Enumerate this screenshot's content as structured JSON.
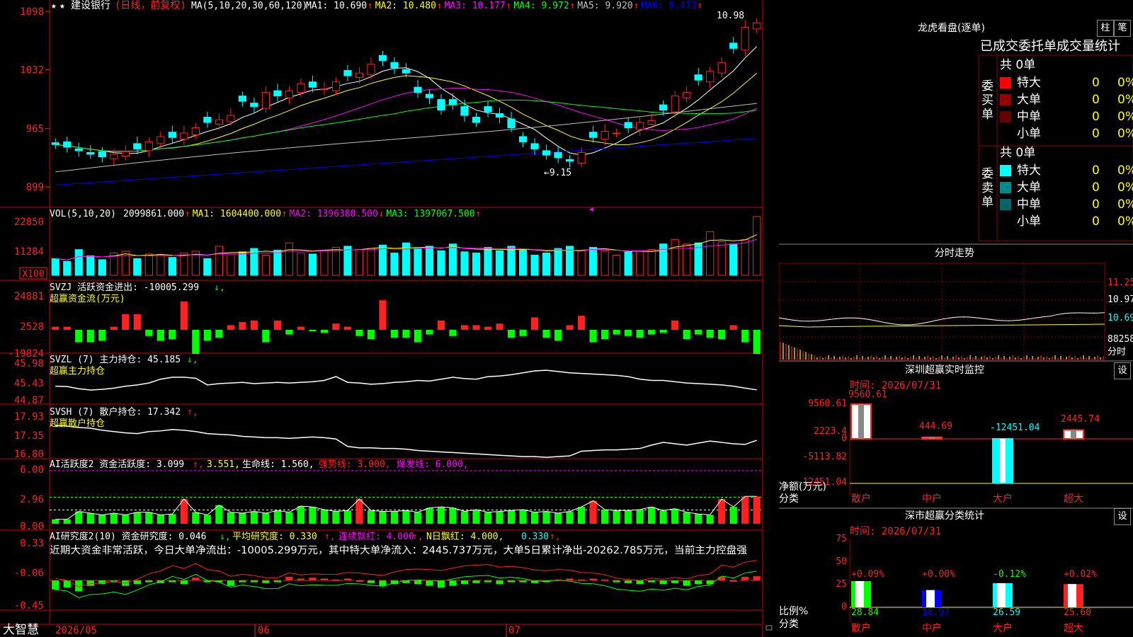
{
  "app": {
    "brand": "大智慧"
  },
  "toolbar": {
    "star_icon": "★",
    "stock_name": "建设银行",
    "period": "(日线，前复权)"
  },
  "colors": {
    "up": "#ff2020",
    "down": "#00ffff",
    "green": "#00ff00",
    "grid": "#8b0000",
    "yellow": "#ffff00",
    "magenta": "#ff00ff",
    "ma1": "#ffffff",
    "ma2": "#ffff00",
    "ma3": "#ff00ff",
    "ma4": "#00ff00",
    "ma5": "#c0c0c0",
    "ma6": "#0000ff"
  },
  "main": {
    "ma_params": "MA(5,10,20,30,60,120)",
    "ma": [
      {
        "label": "MA1: 10.690",
        "arrow": "↑",
        "color": "#ffffff"
      },
      {
        "label": "MA2: 10.480",
        "arrow": "↑",
        "color": "#ffff00"
      },
      {
        "label": "MA3: 10.177",
        "arrow": "↑",
        "color": "#ff00ff"
      },
      {
        "label": "MA4: 9.972",
        "arrow": "↑",
        "color": "#00ff00"
      },
      {
        "label": "MA5: 9.920",
        "arrow": "↑",
        "color": "#c0c0c0"
      },
      {
        "label": "MA6: 9.471",
        "arrow": "↑",
        "color": "#0000ff"
      }
    ],
    "high_label": "10.98",
    "low_label": "←9.15",
    "y_ticks": [
      "1098",
      "1032",
      "965",
      "899"
    ]
  },
  "vol": {
    "header": "VOL(5,10,20)",
    "items": [
      {
        "label": "2099861.000",
        "arrow": "↑",
        "color": "#ffffff"
      },
      {
        "label": "MA1: 1604400.000",
        "arrow": "↑",
        "color": "#ffff00"
      },
      {
        "label": "MA2: 1396380.500",
        "arrow": "↓",
        "color": "#ff00ff"
      },
      {
        "label": "MA3: 1397067.500",
        "arrow": "↑",
        "color": "#00ff00"
      }
    ],
    "y_ticks": [
      "22850",
      "11284"
    ],
    "unit": "X100"
  },
  "svzj": {
    "title": "SVZJ  活跃资金进出: -10005.299",
    "arrow": "↓,",
    "subtitle": "超赢资金流(万元)",
    "y_ticks": [
      "24881",
      "2528",
      "-19824"
    ]
  },
  "svzl": {
    "title": "SVZL (7) 主力持仓: 45.185",
    "arrow": "↓,",
    "subtitle": "超赢主力持仓",
    "y_ticks": [
      "45.98",
      "45.43",
      "44.87"
    ]
  },
  "svsh": {
    "title": "SVSH (7) 散户持仓: 17.342",
    "arrow": "↑,",
    "subtitle": "超赢散户持仓",
    "y_ticks": [
      "17.93",
      "17.35",
      "16.80"
    ]
  },
  "ai1": {
    "title": "AI活跃度2 资金活跃度: 3.099",
    "a1": "↑,",
    "v2": "3.551,",
    "v3": "生命线: 1.560,",
    "v4": "强势线: 3.000,",
    "v5": "爆发线: 6.000,",
    "y_ticks": [
      "6.00",
      "2.96",
      "0.00"
    ]
  },
  "ai2": {
    "title": "AI研究度2(10) 资金研究度: 0.046",
    "a1": "↓,",
    "v2": "平均研究度: 0.330",
    "a2": "↑,",
    "v3": "连续飘红: 4.000",
    "a3": "↑,",
    "v4": "N日飘红: 4.000,",
    "v5": "0.330",
    "a5": "↑,",
    "desc": "近期大资金非常活跃，今日大单净流出：-10005.299万元，其中特大单净流入：2445.737万元，大单5日累计净出-20262.785万元，当前主力控盘强",
    "y_ticks": [
      "0.33",
      "-0.06",
      "-0.45"
    ]
  },
  "xaxis": {
    "labels": [
      "2026/05",
      "06",
      "07"
    ]
  },
  "lhb": {
    "title": "龙虎看盘(逐单)",
    "btn_bar": "柱",
    "btn_pen": "笔",
    "header": "已成交委托单成交量统计",
    "buy_label": [
      "委",
      "买",
      "单"
    ],
    "sell_label": [
      "委",
      "卖",
      "单"
    ],
    "buy_total": "共 0单",
    "sell_total": "共 0单",
    "buy_rows": [
      {
        "name": "特大",
        "count": "0",
        "pct": "0%",
        "color": "#ff0000"
      },
      {
        "name": "大单",
        "count": "0",
        "pct": "0%",
        "color": "#990000"
      },
      {
        "name": "中单",
        "count": "0",
        "pct": "0%",
        "color": "#660000"
      },
      {
        "name": "小单",
        "count": "0",
        "pct": "0%",
        "color": "#000000"
      }
    ],
    "sell_rows": [
      {
        "name": "特大",
        "count": "0",
        "pct": "0%",
        "color": "#00ffff"
      },
      {
        "name": "大单",
        "count": "0",
        "pct": "0%",
        "color": "#008b8b"
      },
      {
        "name": "中单",
        "count": "0",
        "pct": "0%",
        "color": "#006666"
      },
      {
        "name": "小单",
        "count": "0",
        "pct": "0%",
        "color": "#000000"
      }
    ]
  },
  "intraday": {
    "title": "分时走势",
    "labels": [
      "11.25",
      "10.97",
      "10.69",
      "88258",
      "分时"
    ]
  },
  "monitor": {
    "title": "深圳超赢实时监控",
    "btn": "设",
    "time": "时间: 2026/07/31",
    "y_ticks": [
      "9560.61",
      "2223.4",
      "0",
      "-5113.82",
      "-12451.04"
    ],
    "unit": "净额(万元)",
    "cat_label": "分类",
    "categories": [
      "散户",
      "中户",
      "大户",
      "超大"
    ],
    "value_labels": [
      "9560.61",
      "444.69",
      "-12451.04",
      "2445.74"
    ]
  },
  "classify": {
    "title": "深市超赢分类统计",
    "btn": "设",
    "time": "时间: 2026/07/31",
    "y_ticks": [
      "75",
      "50",
      "25",
      "0"
    ],
    "unit": "比例%",
    "cat_label": "分类",
    "categories": [
      "散户",
      "中户",
      "大户",
      "超大"
    ],
    "change_labels": [
      "+0.09%",
      "+0.00%",
      "-0.12%",
      "+0.02%"
    ],
    "value_labels": [
      "28.84",
      "18.97",
      "26.59",
      "25.60"
    ]
  },
  "chart_data": [
    {
      "type": "candlestick",
      "title": "建设银行",
      "x": [
        "2026/05",
        "06",
        "07"
      ],
      "ohlc_count": 61,
      "ylim": [
        8.99,
        10.98
      ],
      "note_high": 10.98,
      "note_low": 9.15,
      "close": [
        9.47,
        9.44,
        9.4,
        9.36,
        9.33,
        9.36,
        9.39,
        9.42,
        9.5,
        9.56,
        9.55,
        9.6,
        9.66,
        9.72,
        9.75,
        9.8,
        9.96,
        9.9,
        10.06,
        10.02,
        10.08,
        10.16,
        10.12,
        10.1,
        10.18,
        10.25,
        10.28,
        10.38,
        10.42,
        10.34,
        10.28,
        10.06,
        10.0,
        9.86,
        9.92,
        9.8,
        9.72,
        9.84,
        9.78,
        9.66,
        9.5,
        9.42,
        9.35,
        9.32,
        9.28,
        9.38,
        9.55,
        9.62,
        9.6,
        9.66,
        9.72,
        9.74,
        9.86,
        10.02,
        10.06,
        10.2,
        10.3,
        10.4,
        10.56,
        10.8,
        10.85
      ],
      "volume": [
        30,
        25,
        46,
        35,
        28,
        40,
        43,
        30,
        38,
        36,
        32,
        40,
        43,
        30,
        52,
        38,
        42,
        48,
        36,
        45,
        58,
        40,
        38,
        44,
        50,
        52,
        46,
        48,
        54,
        40,
        58,
        48,
        52,
        44,
        56,
        42,
        40,
        50,
        44,
        52,
        46,
        36,
        40,
        48,
        52,
        44,
        50,
        44,
        36,
        42,
        44,
        46,
        56,
        64,
        56,
        58,
        78,
        60,
        56,
        64,
        105
      ]
    },
    {
      "type": "bar",
      "title": "SVZJ",
      "values": [
        2,
        2,
        -8,
        -8,
        -7,
        2,
        10,
        10,
        -4,
        -7,
        -6,
        24881,
        -19824,
        -7,
        -5,
        3,
        5,
        6,
        -8,
        6,
        -3,
        2,
        -1,
        -2,
        4,
        2,
        -4,
        -6,
        19,
        -5,
        -5,
        -8,
        -3,
        6,
        -4,
        3,
        3,
        2,
        4,
        -5,
        -4,
        8,
        -5,
        -7,
        3,
        9,
        -8,
        -6,
        -3,
        -4,
        -5,
        -3,
        -2,
        6,
        -6,
        -3,
        -5,
        -6,
        3,
        -8,
        -10005
      ]
    },
    {
      "type": "line",
      "title": "SVZL",
      "ylim": [
        44.87,
        45.98
      ],
      "values": [
        45.3,
        45.29,
        45.22,
        45.18,
        45.2,
        45.24,
        45.3,
        45.34,
        45.4,
        45.52,
        45.58,
        45.58,
        45.55,
        45.34,
        45.38,
        45.4,
        45.42,
        45.38,
        45.4,
        45.42,
        45.4,
        45.42,
        45.44,
        45.48,
        45.6,
        45.42,
        45.4,
        45.36,
        45.38,
        45.42,
        45.44,
        45.48,
        45.46,
        45.52,
        45.58,
        45.54,
        45.52,
        45.6,
        45.62,
        45.66,
        45.72,
        45.78,
        45.8,
        45.76,
        45.72,
        45.7,
        45.68,
        45.66,
        45.64,
        45.6,
        45.52,
        45.48,
        45.48,
        45.44,
        45.4,
        45.38,
        45.36,
        45.34,
        45.3,
        45.24,
        45.185
      ]
    },
    {
      "type": "line",
      "title": "SVSH",
      "ylim": [
        16.8,
        17.93
      ],
      "values": [
        17.78,
        17.76,
        17.72,
        17.7,
        17.64,
        17.6,
        17.56,
        17.54,
        17.6,
        17.62,
        17.66,
        17.64,
        17.6,
        17.54,
        17.52,
        17.5,
        17.46,
        17.44,
        17.42,
        17.42,
        17.4,
        17.42,
        17.44,
        17.42,
        17.38,
        17.16,
        17.12,
        17.12,
        17.1,
        17.1,
        17.08,
        17.04,
        17.02,
        17.0,
        16.98,
        16.96,
        16.94,
        16.92,
        16.9,
        16.88,
        16.86,
        16.86,
        16.84,
        16.86,
        16.88,
        17.02,
        17.04,
        17.06,
        17.06,
        17.08,
        17.1,
        17.2,
        17.28,
        17.24,
        17.2,
        17.26,
        17.32,
        17.28,
        17.24,
        17.22,
        17.342
      ]
    },
    {
      "type": "bar",
      "title": "AI活跃度2",
      "ylim": [
        0,
        6
      ],
      "series_lines": [
        {
          "name": "生命线",
          "value": 1.56
        },
        {
          "name": "强势线",
          "value": 3.0
        },
        {
          "name": "爆发线",
          "value": 6.0
        }
      ],
      "values": [
        0.5,
        0.5,
        1.4,
        1.2,
        1.0,
        1.2,
        1.0,
        1.3,
        1.3,
        1.0,
        1.1,
        2.8,
        1.3,
        1.0,
        2.1,
        1.3,
        1.2,
        1.4,
        1.2,
        1.5,
        1.3,
        2.0,
        1.9,
        1.6,
        1.4,
        1.5,
        2.8,
        1.5,
        1.4,
        1.4,
        1.5,
        1.3,
        1.8,
        1.9,
        1.8,
        1.4,
        1.6,
        1.3,
        1.4,
        1.5,
        1.6,
        1.3,
        1.4,
        1.2,
        1.4,
        1.9,
        2.6,
        1.6,
        1.5,
        1.5,
        1.6,
        1.9,
        1.5,
        1.7,
        1.3,
        1.1,
        1.0,
        2.8,
        1.9,
        3.1,
        3.099
      ]
    },
    {
      "type": "bar",
      "title": "AI研究度2",
      "ylim": [
        -0.45,
        0.33
      ],
      "values": [
        -0.1,
        -0.08,
        -0.12,
        -0.06,
        -0.04,
        -0.02,
        -0.06,
        -0.04,
        -0.02,
        -0.03,
        -0.02,
        -0.04,
        0.03,
        -0.02,
        -0.02,
        -0.06,
        -0.02,
        -0.02,
        -0.03,
        -0.02,
        0.04,
        0.02,
        0.03,
        0.02,
        0.01,
        0.02,
        0.0,
        -0.03,
        -0.06,
        -0.04,
        -0.03,
        -0.04,
        -0.06,
        -0.08,
        -0.06,
        -0.04,
        -0.03,
        -0.02,
        -0.04,
        -0.02,
        -0.02,
        -0.03,
        -0.02,
        0.01,
        0.02,
        0.01,
        0.02,
        0.01,
        -0.02,
        -0.03,
        -0.04,
        -0.02,
        -0.04,
        -0.03,
        -0.06,
        -0.04,
        -0.04,
        0.04,
        0.0,
        0.04,
        0.046
      ]
    }
  ]
}
